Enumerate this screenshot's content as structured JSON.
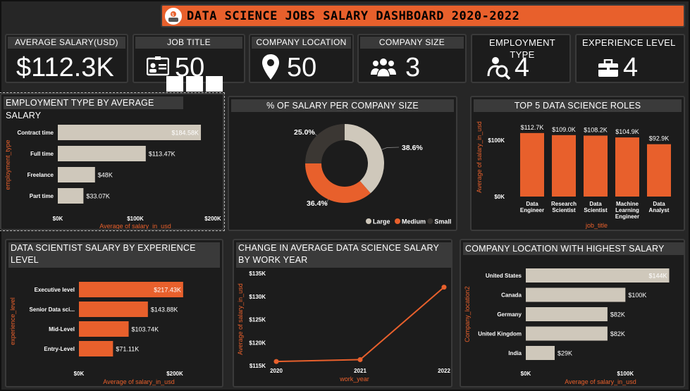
{
  "title": "DATA SCIENCE JOBS SALARY DASHBOARD 2020-2022",
  "colors": {
    "orange": "#e8602c",
    "beige": "#cfc8bb",
    "dark": "#3b3733",
    "bg": "#262626"
  },
  "kpis": {
    "avg_salary": {
      "label": "AVERAGE SALARY(USD)",
      "value": "$112.3K"
    },
    "job_title": {
      "label": "JOB TITLE",
      "value": "50",
      "icon": "id-card-icon"
    },
    "company_location": {
      "label": "COMPANY LOCATION",
      "value": "50",
      "icon": "map-pin-icon"
    },
    "company_size": {
      "label": "COMPANY SIZE",
      "value": "3",
      "icon": "people-group-icon"
    },
    "employment_type": {
      "label": "EMPLOYMENT TYPE",
      "value": "4",
      "icon": "person-search-icon"
    },
    "experience_level": {
      "label": "EXPERIENCE LEVEL",
      "value": "4",
      "icon": "briefcase-icon"
    }
  },
  "chart_data": [
    {
      "id": "employment",
      "type": "bar",
      "orientation": "horizontal",
      "title": "EMPLOYMENT TYPE BY AVERAGE SALARY",
      "categories": [
        "Contract time",
        "Full time",
        "Freelance",
        "Part time"
      ],
      "values": [
        184.58,
        113.47,
        48,
        33.07
      ],
      "data_labels": [
        "$184.58K",
        "$113.47K",
        "$48K",
        "$33.07K"
      ],
      "xlabel": "Average of salary_in_usd",
      "ylabel": "employment_type",
      "xticks": [
        "$0K",
        "$100K",
        "$200K"
      ],
      "xlim": [
        0,
        200
      ],
      "color": "#cfc8bb"
    },
    {
      "id": "company_size",
      "type": "pie",
      "variant": "donut",
      "title": "% OF SALARY PER COMPANY SIZE",
      "categories": [
        "Large",
        "Medium",
        "Small"
      ],
      "values": [
        38.6,
        36.4,
        25.0
      ],
      "data_labels": [
        "38.6%",
        "36.4%",
        "25.0%"
      ],
      "colors": [
        "#cfc8bb",
        "#e8602c",
        "#3b3733"
      ],
      "legend": "bottom-right"
    },
    {
      "id": "roles",
      "type": "bar",
      "orientation": "vertical",
      "title": "TOP 5 DATA SCIENCE ROLES",
      "categories": [
        "Data Engineer",
        "Research Scientist",
        "Data Scientist",
        "Machine Learning Engineer",
        "Data Analyst"
      ],
      "category_lines": [
        [
          "Data",
          "Engineer"
        ],
        [
          "Research",
          "Scientist"
        ],
        [
          "Data",
          "Scientist"
        ],
        [
          "Machine",
          "Learning",
          "Engineer"
        ],
        [
          "Data",
          "Analyst"
        ]
      ],
      "values": [
        112.7,
        109.0,
        108.2,
        104.9,
        92.9
      ],
      "data_labels": [
        "$112.7K",
        "$109.0K",
        "$108.2K",
        "$104.9K",
        "$92.9K"
      ],
      "xlabel": "job_title",
      "ylabel": "Average of salary_in_usd",
      "yticks": [
        "$0K",
        "$100K"
      ],
      "ylim": [
        0,
        140
      ],
      "color": "#e8602c"
    },
    {
      "id": "experience",
      "type": "bar",
      "orientation": "horizontal",
      "title": "DATA SCIENTIST SALARY BY EXPERIENCE LEVEL",
      "categories": [
        "Executive level",
        "Senior Data sci...",
        "Mid-Level",
        "Entry-Level"
      ],
      "values": [
        217.43,
        143.88,
        103.74,
        71.11
      ],
      "data_labels": [
        "$217.43K",
        "$143.88K",
        "$103.74K",
        "$71.11K"
      ],
      "xlabel": "Average of salary_in_usd",
      "ylabel": "experience_level",
      "xticks": [
        "$0K",
        "$200K"
      ],
      "xlim": [
        0,
        250
      ],
      "color": "#e8602c"
    },
    {
      "id": "year",
      "type": "line",
      "title": "CHANGE IN AVERAGE DATA SCIENCE SALARY BY WORK YEAR",
      "x": [
        "2020",
        "2021",
        "2022"
      ],
      "values": [
        115.9,
        116.3,
        132.0
      ],
      "xlabel": "work_year",
      "ylabel": "Average of salary_in_usd",
      "yticks": [
        "$115K",
        "$120K",
        "$125K",
        "$130K",
        "$135K"
      ],
      "ylim": [
        115,
        135
      ],
      "color": "#e8602c"
    },
    {
      "id": "location",
      "type": "bar",
      "orientation": "horizontal",
      "title": "COMPANY LOCATION WITH HIGHEST SALARY",
      "categories": [
        "United States",
        "Canada",
        "Germany",
        "United Kingdom",
        "India"
      ],
      "values": [
        144,
        100,
        82,
        82,
        29
      ],
      "data_labels": [
        "$144K",
        "$100K",
        "$82K",
        "$82K",
        "$29K"
      ],
      "xlabel": "Average of salary_in_usd",
      "ylabel": "Company_location2",
      "xticks": [
        "$0K",
        "$100K"
      ],
      "xlim": [
        0,
        150
      ],
      "color": "#cfc8bb"
    }
  ]
}
